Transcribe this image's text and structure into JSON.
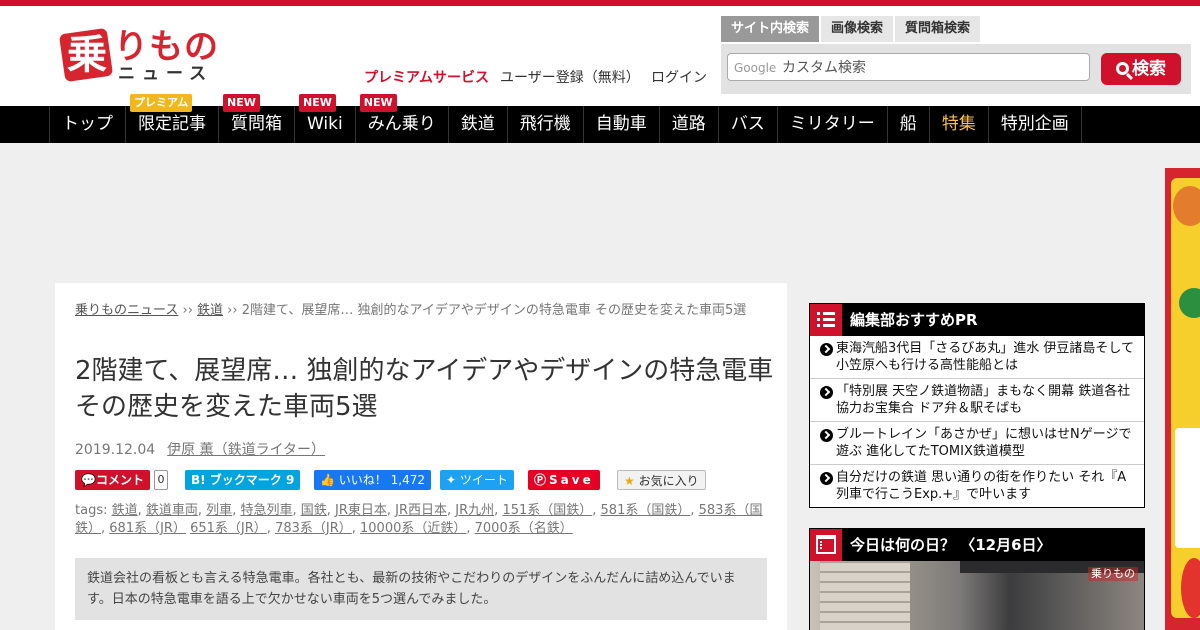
{
  "logo": {
    "kanji": "乗",
    "kana": "りもの",
    "news": "ニュース"
  },
  "header_links": {
    "premium": "プレミアムサービス",
    "register": "ユーザー登録（無料）",
    "login": "ログイン"
  },
  "search": {
    "tabs": [
      "サイト内検索",
      "画像検索",
      "質問箱検索"
    ],
    "google_label": "Google",
    "placeholder": "カスタム検索",
    "button_label": "検索"
  },
  "nav": {
    "items": [
      {
        "label": "トップ",
        "badge": ""
      },
      {
        "label": "限定記事",
        "badge": "プレミアム"
      },
      {
        "label": "質問箱",
        "badge": "NEW"
      },
      {
        "label": "Wiki",
        "badge": "NEW"
      },
      {
        "label": "みん乗り",
        "badge": "NEW"
      },
      {
        "label": "鉄道",
        "badge": ""
      },
      {
        "label": "飛行機",
        "badge": ""
      },
      {
        "label": "自動車",
        "badge": ""
      },
      {
        "label": "道路",
        "badge": ""
      },
      {
        "label": "バス",
        "badge": ""
      },
      {
        "label": "ミリタリー",
        "badge": ""
      },
      {
        "label": "船",
        "badge": ""
      },
      {
        "label": "特集",
        "badge": ""
      },
      {
        "label": "特別企画",
        "badge": ""
      }
    ],
    "feature_color": "#f5c14a"
  },
  "breadcrumb": {
    "home": "乗りものニュース",
    "sep": " ›› ",
    "category": "鉄道",
    "current": "2階建て、展望席… 独創的なアイデアやデザインの特急電車 その歴史を変えた車両5選"
  },
  "article": {
    "title": "2階建て、展望席… 独創的なアイデアやデザインの特急電車 その歴史を変えた車両5選",
    "date": "2019.12.04",
    "author": "伊原 薫（鉄道ライター）",
    "share": {
      "comment": "コメント",
      "comment_count": "0",
      "hatena": "B! ブックマーク",
      "hatena_count": "9",
      "fb": "いいね！",
      "fb_count": "1,472",
      "tweet": "ツイート",
      "pin": "Save",
      "fav": "お気に入り"
    },
    "tags_label": "tags: ",
    "tags": [
      "鉄道",
      "鉄道車両",
      "列車",
      "特急列車",
      "国鉄",
      "JR東日本",
      "JR西日本",
      "JR九州",
      "151系（国鉄）",
      "581系（国鉄）",
      "583系（国鉄）",
      "681系（JR）",
      "651系（JR）",
      "783系（JR）",
      "10000系（近鉄）",
      "7000系（名鉄）"
    ],
    "lead": "鉄道会社の看板とも言える特急電車。各社とも、最新の技術やこだわりのデザインをふんだんに詰め込んでいます。日本の特急電車を語る上で欠かせない車両を5つ選んでみました。"
  },
  "sidebar": {
    "recommend_title": "編集部おすすめPR",
    "recommend_items": [
      "東海汽船3代目「さるびあ丸」進水 伊豆諸島そして小笠原へも行ける高性能船とは",
      "「特別展 天空ノ鉄道物語」まもなく開幕 鉄道各社協力お宝集合 ドア弁＆駅そばも",
      "ブルートレイン「あさかぜ」に想いはせNゲージで遊ぶ 進化してたTOMIX鉄道模型",
      "自分だけの鉄道 思い通りの街を作りたい それ『A列車で行こうExp.+』で叶います"
    ],
    "today_title": "今日は何の日？ 〈12月6日〉"
  },
  "colors": {
    "brand_red": "#d0112b",
    "nav_bg": "#000000"
  }
}
